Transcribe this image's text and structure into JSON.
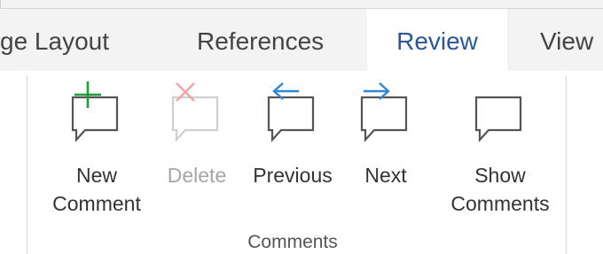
{
  "tabs": [
    {
      "label": "ge Layout",
      "active": false
    },
    {
      "label": "References",
      "active": false
    },
    {
      "label": "Review",
      "active": true
    },
    {
      "label": "View",
      "active": false
    }
  ],
  "comments_group": {
    "label": "Comments",
    "buttons": [
      {
        "label": "New Comment",
        "icon": "new-comment-icon",
        "enabled": true
      },
      {
        "label": "Delete",
        "icon": "delete-comment-icon",
        "enabled": false
      },
      {
        "label": "Previous",
        "icon": "previous-comment-icon",
        "enabled": true
      },
      {
        "label": "Next",
        "icon": "next-comment-icon",
        "enabled": true
      },
      {
        "label": "Show Comments",
        "icon": "show-comments-icon",
        "enabled": true
      }
    ]
  },
  "colors": {
    "active_tab_text": "#2b579a",
    "new_plus": "#1f9d3a",
    "delete_x": "#f2a3a3",
    "arrows": "#2e86d6",
    "disabled_text": "#a6a6a6"
  }
}
